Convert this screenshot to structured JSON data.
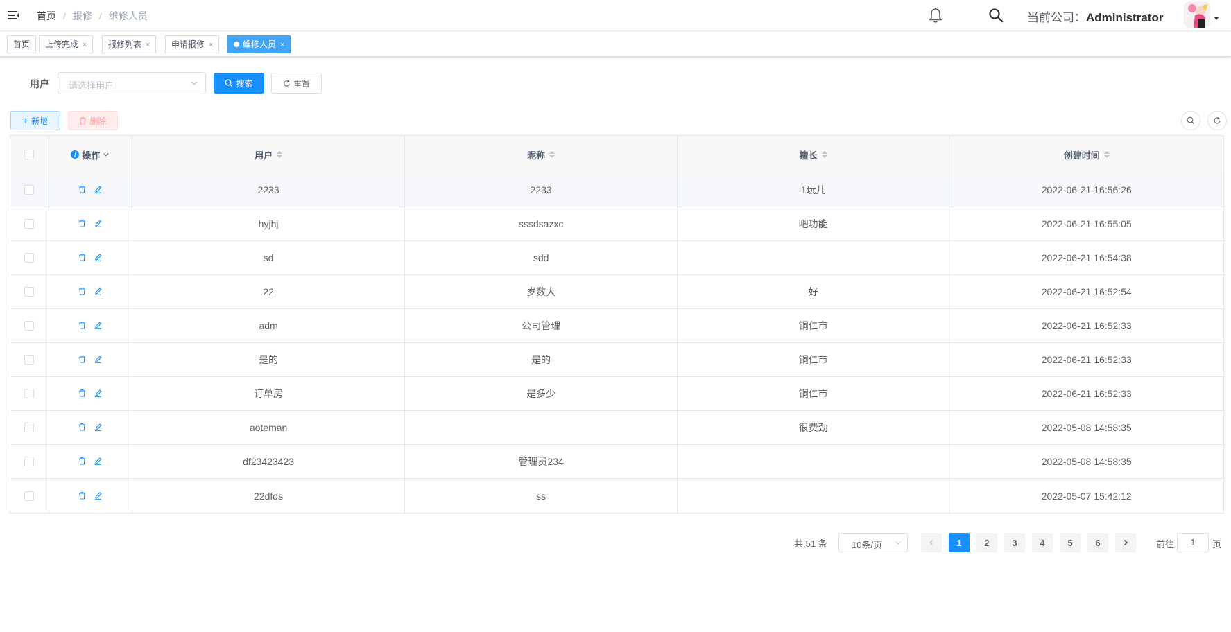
{
  "navbar": {
    "breadcrumb": [
      "首页",
      "报修",
      "维修人员"
    ],
    "company_label": "当前公司：",
    "company_name": "Administrator"
  },
  "tags": [
    {
      "label": "首页",
      "closable": false,
      "active": false
    },
    {
      "label": "上传完成",
      "closable": true,
      "active": false
    },
    {
      "label": "报修列表",
      "closable": true,
      "active": false
    },
    {
      "label": "申请报修",
      "closable": true,
      "active": false
    },
    {
      "label": "维修人员",
      "closable": true,
      "active": true
    }
  ],
  "search": {
    "user_label": "用户",
    "user_placeholder": "请选择用户",
    "search_button": "搜索",
    "reset_button": "重置"
  },
  "toolbar": {
    "add_button": "新增",
    "delete_button": "删除"
  },
  "table": {
    "columns": [
      "操作",
      "用户",
      "昵称",
      "擅长",
      "创建时间"
    ],
    "rows": [
      {
        "user": "2233",
        "nickname": "2233",
        "skill": "1玩儿",
        "created": "2022-06-21 16:56:26"
      },
      {
        "user": "hyjhj",
        "nickname": "sssdsazxc",
        "skill": "吧功能",
        "created": "2022-06-21 16:55:05"
      },
      {
        "user": "sd",
        "nickname": "sdd",
        "skill": "",
        "created": "2022-06-21 16:54:38"
      },
      {
        "user": "22",
        "nickname": "岁数大",
        "skill": "好",
        "created": "2022-06-21 16:52:54"
      },
      {
        "user": "adm",
        "nickname": "公司管理",
        "skill": "铜仁市",
        "created": "2022-06-21 16:52:33"
      },
      {
        "user": "是的",
        "nickname": "是的",
        "skill": "铜仁市",
        "created": "2022-06-21 16:52:33"
      },
      {
        "user": "订单房",
        "nickname": "是多少",
        "skill": "铜仁市",
        "created": "2022-06-21 16:52:33"
      },
      {
        "user": "aoteman",
        "nickname": "",
        "skill": "很费劲",
        "created": "2022-05-08 14:58:35"
      },
      {
        "user": "df23423423",
        "nickname": "管理员234",
        "skill": "",
        "created": "2022-05-08 14:58:35"
      },
      {
        "user": "22dfds",
        "nickname": "ss",
        "skill": "",
        "created": "2022-05-07 15:42:12"
      }
    ]
  },
  "pagination": {
    "total_text": "共 51 条",
    "page_size": "10条/页",
    "pages": [
      "1",
      "2",
      "3",
      "4",
      "5",
      "6"
    ],
    "current_page": "1",
    "goto_label": "前往",
    "goto_value": "1",
    "goto_suffix": "页"
  },
  "colors": {
    "primary": "#1890ff",
    "active_tag": "#42a5f5",
    "danger_plain": "#ffa3a3"
  }
}
